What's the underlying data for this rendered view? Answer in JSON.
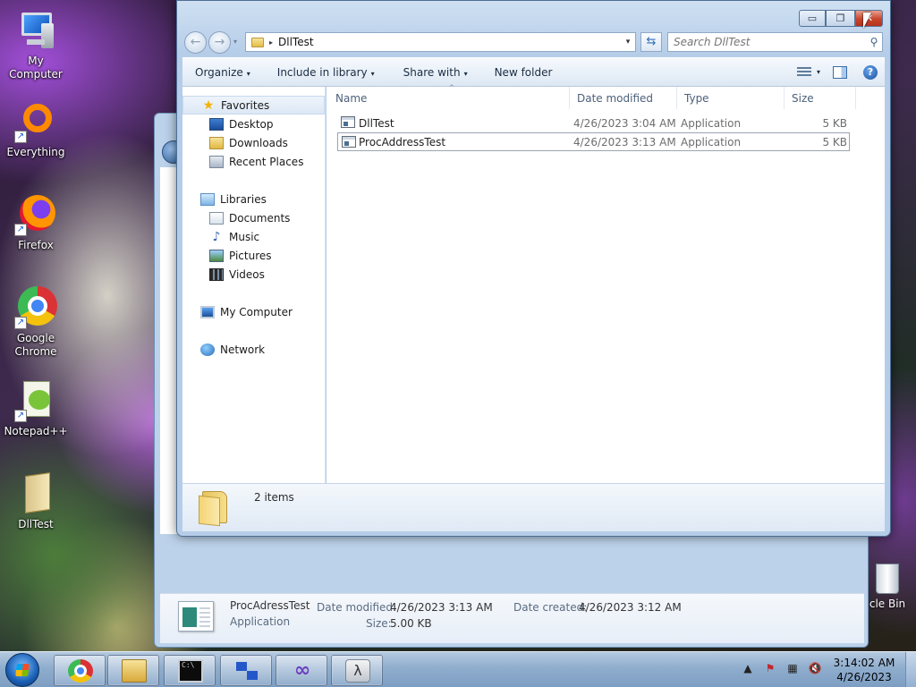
{
  "desktop": {
    "icons": [
      {
        "label": "My Computer",
        "icon": "computer-icon"
      },
      {
        "label": "Everything",
        "icon": "everything-icon"
      },
      {
        "label": "Firefox",
        "icon": "firefox-icon"
      },
      {
        "label": "Google Chrome",
        "icon": "chrome-icon"
      },
      {
        "label": "Notepad++",
        "icon": "notepad-plus-plus-icon"
      },
      {
        "label": "DllTest",
        "icon": "dlltest-icon"
      }
    ],
    "recycle_bin_label": "cle Bin"
  },
  "window": {
    "caption_buttons": {
      "minimize": "▭",
      "maximize": "❐",
      "close": "✕"
    },
    "address": {
      "crumb_sep": "▸",
      "path": "DllTest",
      "dropdown": "▾"
    },
    "nav_buttons": {
      "back": "←",
      "forward": "→",
      "history": "▾"
    },
    "refresh_glyph": "⇆",
    "search": {
      "placeholder": "Search DllTest",
      "value": "",
      "icon": "⚲"
    },
    "toolbar": {
      "organize": "Organize",
      "include_in_library": "Include in library",
      "share_with": "Share with",
      "new_folder": "New folder",
      "caret": "▾",
      "help": "?"
    },
    "nav_pane": {
      "favorites": "Favorites",
      "desktop": "Desktop",
      "downloads": "Downloads",
      "recent_places": "Recent Places",
      "libraries": "Libraries",
      "documents": "Documents",
      "music": "Music",
      "pictures": "Pictures",
      "videos": "Videos",
      "my_computer": "My Computer",
      "network": "Network",
      "star_glyph": "★",
      "music_glyph": "♪"
    },
    "columns": {
      "name": "Name",
      "date_modified": "Date modified",
      "type": "Type",
      "size": "Size",
      "sort_glyph": "^"
    },
    "files": [
      {
        "name": "DllTest",
        "date_modified": "4/26/2023 3:04 AM",
        "type": "Application",
        "size": "5 KB",
        "selected": false
      },
      {
        "name": "ProcAddressTest",
        "date_modified": "4/26/2023 3:13 AM",
        "type": "Application",
        "size": "5 KB",
        "selected": true
      }
    ],
    "status": {
      "item_count": "2 items"
    }
  },
  "background_window": {
    "details": {
      "file_name": "ProcAdressTest",
      "file_type": "Application",
      "date_modified_label": "Date modified:",
      "date_modified": "4/26/2023 3:13 AM",
      "date_created_label": "Date created:",
      "date_created": "4/26/2023 3:12 AM",
      "size_label": "Size:",
      "size": "5.00 KB"
    }
  },
  "taskbar": {
    "pinned": [
      "chrome-icon",
      "windows-explorer-icon",
      "command-prompt-icon",
      "diagram-app-icon",
      "infinity-app-icon",
      "lambda-app-icon"
    ],
    "cmd_glyph": "C:\\",
    "infinity_glyph": "∞",
    "lambda_glyph": "λ",
    "tray": {
      "show_hidden": "▲",
      "flag": "⚑",
      "network": "▦",
      "volume": "🔇"
    },
    "clock": {
      "time": "3:14:02 AM",
      "date": "4/26/2023"
    }
  }
}
